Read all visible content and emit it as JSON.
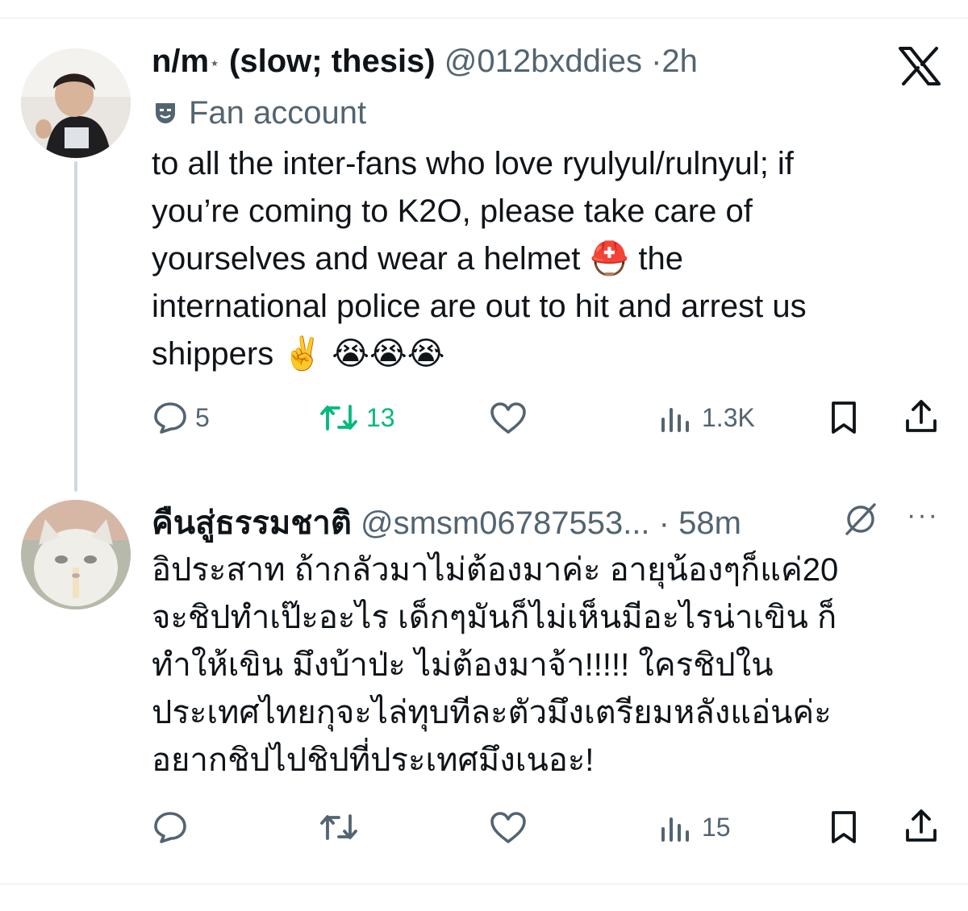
{
  "tweet1": {
    "display_name": "n/m",
    "badge": "⋆",
    "name_suffix": "(slow; thesis)",
    "handle": "@012bxddies",
    "dot": "·",
    "time": "2h",
    "label": "Fan account",
    "text_lines": [
      "to all the inter-fans who love ryulyul/rulnyul; if",
      "you’re coming to K2O, please take care of",
      "yourselves and wear a helmet ⛑️ the",
      "international police are out to hit and arrest us",
      "shippers ✌️ 😭😭😭"
    ],
    "replies": "5",
    "reposts": "13",
    "views": "1.3K"
  },
  "tweet2": {
    "display_name": "คืนสู่ธรรมชาติ",
    "handle": "@smsm06787553...",
    "dot": "·",
    "time": "58m",
    "text_lines": [
      "อิประสาท ถ้ากลัวมาไม่ต้องมาค่ะ อายุน้องๆก็แค่20",
      "จะชิปทำเป๊ะอะไร เด็กๆมันก็ไม่เห็นมีอะไรน่าเขิน ก็",
      "ทำให้เขิน มึงบ้าป่ะ ไม่ต้องมาจ้า!!!!! ใครชิปใน",
      "ประเทศไทยกุจะไล่ทุบทีละตัวมึงเตรียมหลังแอ่นค่ะ",
      "อยากชิปไปชิปที่ประเทศมึงเนอะ!"
    ],
    "views": "15",
    "more": "···"
  },
  "icons": {
    "logo": "x-logo-icon",
    "reply": "reply-icon",
    "repost": "repost-icon",
    "like": "like-icon",
    "views": "views-icon",
    "bookmark": "bookmark-icon",
    "share": "share-icon"
  },
  "colors": {
    "text": "#0f1419",
    "secondary": "#536471",
    "repost_active": "#00ba7c",
    "divider": "#e6e9ec"
  }
}
